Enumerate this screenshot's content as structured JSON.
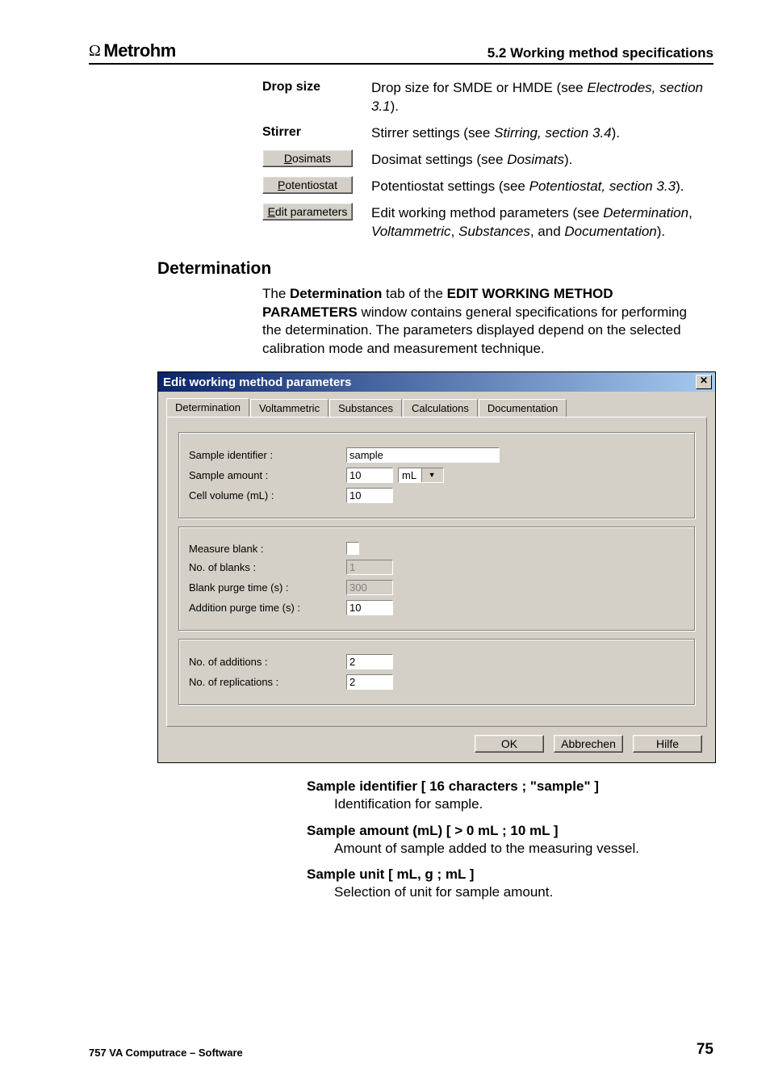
{
  "header": {
    "logo_text": "Metrohm",
    "section_title": "5.2  Working method specifications"
  },
  "defs": {
    "drop_size": {
      "label": "Drop size",
      "text_1": "Drop size for SMDE or HMDE (see ",
      "ital_1": "Electrodes, section 3.1",
      "text_2": ")."
    },
    "stirrer": {
      "label": "Stirrer",
      "text_1": "Stirrer settings (see ",
      "ital_1": "Stirring, section 3.4",
      "text_2": ")."
    },
    "dosimats": {
      "btn": "Dosimats",
      "text_1": "Dosimat settings (see ",
      "ital_1": "Dosimats",
      "text_2": ")."
    },
    "potentiostat": {
      "btn": "Potentiostat",
      "text_1": "Potentiostat settings (see ",
      "ital_1": "Potentiostat, section 3.3",
      "text_2": ")."
    },
    "edit_params": {
      "btn": "Edit parameters",
      "text_1": "Edit working method parameters (see ",
      "ital_1": "Determination",
      "text_2": ", ",
      "ital_2": "Voltammetric",
      "text_3": ", ",
      "ital_3": "Substances",
      "text_4": ", and ",
      "ital_4": "Documentation",
      "text_5": ")."
    }
  },
  "section_heading": "Determination",
  "intro": {
    "t1": "The ",
    "b1": "Determination",
    "t2": " tab of the ",
    "b2": "EDIT WORKING METHOD PARAMETERS",
    "t3": " window contains general specifications for performing the determination. The parameters displayed depend on the selected calibration mode and measurement technique."
  },
  "dialog": {
    "title": "Edit working method parameters",
    "close_glyph": "✕",
    "tabs": [
      "Determination",
      "Voltammetric",
      "Substances",
      "Calculations",
      "Documentation"
    ],
    "fields": {
      "sample_identifier": {
        "label": "Sample identifier :",
        "value": "sample"
      },
      "sample_amount": {
        "label": "Sample amount :",
        "value": "10",
        "unit": "mL",
        "arrow": "▼"
      },
      "cell_volume": {
        "label": "Cell volume (mL) :",
        "value": "10"
      },
      "measure_blank": {
        "label": "Measure blank :"
      },
      "no_of_blanks": {
        "label": "No. of blanks :",
        "value": "1"
      },
      "blank_purge": {
        "label": "Blank purge time (s) :",
        "value": "300"
      },
      "addition_purge": {
        "label": "Addition purge time (s) :",
        "value": "10"
      },
      "no_additions": {
        "label": "No. of additions :",
        "value": "2"
      },
      "no_replications": {
        "label": "No. of replications :",
        "value": "2"
      }
    },
    "buttons": {
      "ok": "OK",
      "cancel": "Abbrechen",
      "help": "Hilfe"
    }
  },
  "param_defs": {
    "sample_id": {
      "title": "Sample identifier   [ 16 characters ; \"sample\" ]",
      "body": "Identification for sample."
    },
    "sample_amount": {
      "title": "Sample amount (mL)   [ > 0 mL ; 10 mL ]",
      "body": "Amount of sample added to the measuring vessel."
    },
    "sample_unit": {
      "title": "Sample unit   [ mL, g ; mL ]",
      "body": "Selection of unit for sample amount."
    }
  },
  "footer": {
    "product": "757 VA Computrace – Software",
    "page": "75"
  }
}
